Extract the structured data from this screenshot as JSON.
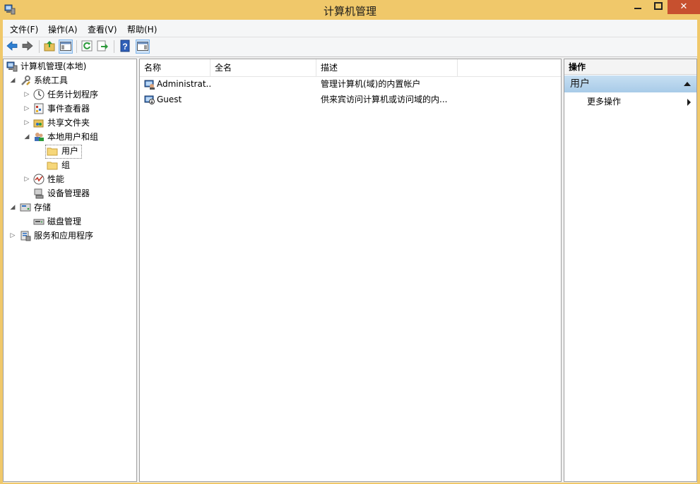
{
  "window": {
    "title": "计算机管理",
    "close_glyph": "✕"
  },
  "menu": [
    "文件(F)",
    "操作(A)",
    "查看(V)",
    "帮助(H)"
  ],
  "toolbar": {
    "buttons": [
      "back-icon",
      "forward-icon",
      "up-folder-icon",
      "show-hide-tree-icon",
      "refresh-icon",
      "export-list-icon",
      "help-icon",
      "show-hide-action-pane-icon"
    ]
  },
  "tree": {
    "root": "计算机管理(本地)",
    "system_tools": "系统工具",
    "task_scheduler": "任务计划程序",
    "event_viewer": "事件查看器",
    "shared_folders": "共享文件夹",
    "local_users_groups": "本地用户和组",
    "users": "用户",
    "groups": "组",
    "performance": "性能",
    "device_manager": "设备管理器",
    "storage": "存储",
    "disk_management": "磁盘管理",
    "services_apps": "服务和应用程序"
  },
  "list": {
    "columns": [
      "名称",
      "全名",
      "描述"
    ],
    "rows": [
      {
        "name": "Administrat...",
        "full_name": "",
        "description": "管理计算机(域)的内置帐户"
      },
      {
        "name": "Guest",
        "full_name": "",
        "description": "供来宾访问计算机或访问域的内..."
      }
    ]
  },
  "actions": {
    "title": "操作",
    "section": "用户",
    "more": "更多操作"
  },
  "colors": {
    "titlebar": "#f0c86a",
    "close_button": "#c7502f",
    "selection_section": "#b8d6ee"
  }
}
